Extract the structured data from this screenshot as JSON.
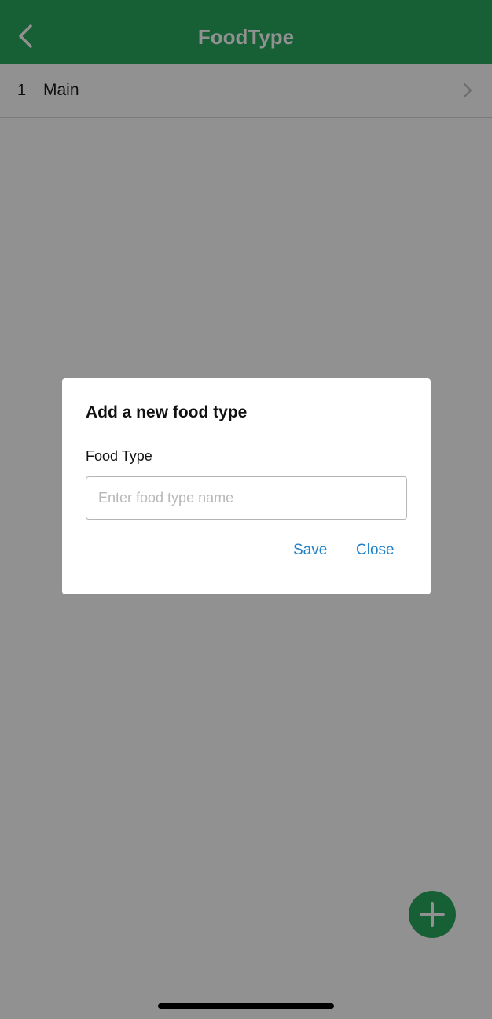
{
  "header": {
    "title": "FoodType",
    "back_icon": "chevron-left-icon",
    "color": "#2aa960"
  },
  "list": {
    "items": [
      {
        "number": "1",
        "label": "Main",
        "icon": "chevron-right-icon"
      }
    ]
  },
  "dialog": {
    "title": "Add a new food type",
    "field_label": "Food Type",
    "input_value": "",
    "input_placeholder": "Enter food type name",
    "save_label": "Save",
    "close_label": "Close",
    "action_color": "#1f82c9"
  },
  "fab": {
    "icon": "plus-icon",
    "color": "#2aa960"
  }
}
